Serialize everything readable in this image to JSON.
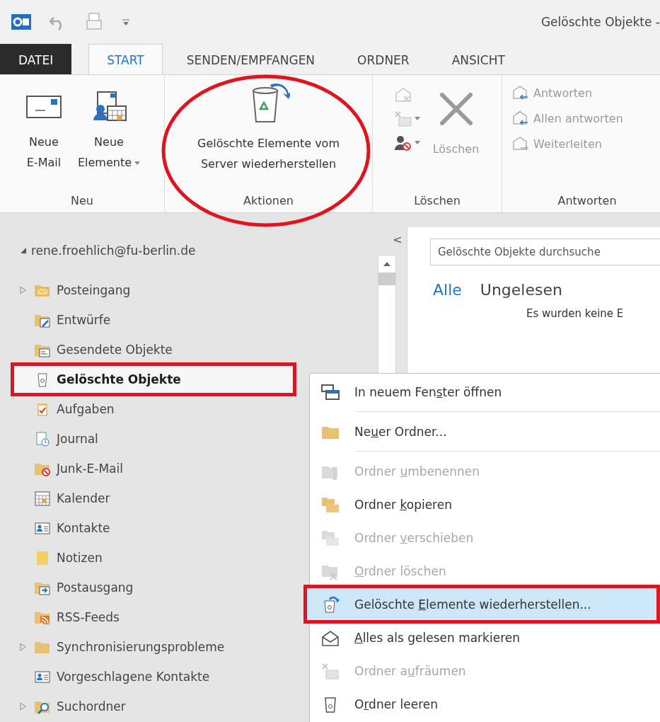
{
  "title_bar": {
    "title": "Gelöschte Objekte -"
  },
  "ribbon_tabs": [
    {
      "label": "DATEI",
      "kind": "backstage",
      "selected": false
    },
    {
      "label": "START",
      "kind": "tab",
      "selected": true
    },
    {
      "label": "SENDEN/EMPFANGEN",
      "kind": "tab",
      "selected": false
    },
    {
      "label": "ORDNER",
      "kind": "tab",
      "selected": false
    },
    {
      "label": "ANSICHT",
      "kind": "tab",
      "selected": false
    }
  ],
  "ribbon_groups": [
    {
      "label": "Neu",
      "buttons": [
        {
          "lines": [
            "Neue",
            "E-Mail"
          ],
          "dropdown": false,
          "disabled": false,
          "annotated": false
        },
        {
          "lines": [
            "Neue",
            "Elemente"
          ],
          "dropdown": true,
          "disabled": false,
          "annotated": false
        }
      ]
    },
    {
      "label": "Aktionen",
      "buttons": [
        {
          "lines": [
            "Gelöschte Elemente vom",
            "Server wiederherstellen"
          ],
          "dropdown": false,
          "disabled": false,
          "annotated": true
        }
      ]
    },
    {
      "label": "Löschen",
      "small_buttons": [
        {
          "dropdown": false,
          "disabled": true
        },
        {
          "dropdown": true,
          "disabled": true
        },
        {
          "dropdown": true,
          "disabled": false
        }
      ],
      "buttons": [
        {
          "lines": [
            "Löschen"
          ],
          "dropdown": false,
          "disabled": true,
          "annotated": false
        }
      ]
    },
    {
      "label": "Antworten",
      "rows": [
        {
          "label": "Antworten",
          "disabled": true
        },
        {
          "label": "Allen antworten",
          "disabled": true
        },
        {
          "label": "Weiterleiten",
          "disabled": true
        }
      ]
    }
  ],
  "navigation": {
    "account": {
      "label": "rene.froehlich@fu-berlin.de",
      "expanded": true
    },
    "folders": [
      {
        "label": "Posteingang",
        "collapsed": true,
        "selected": false,
        "annotated": false
      },
      {
        "label": "Entwürfe",
        "collapsed": false,
        "selected": false,
        "annotated": false
      },
      {
        "label": "Gesendete Objekte",
        "collapsed": false,
        "selected": false,
        "annotated": false
      },
      {
        "label": "Gelöschte Objekte",
        "collapsed": false,
        "selected": true,
        "annotated": true
      },
      {
        "label": "Aufgaben",
        "collapsed": false,
        "selected": false,
        "annotated": false
      },
      {
        "label": "Journal",
        "collapsed": false,
        "selected": false,
        "annotated": false
      },
      {
        "label": "Junk-E-Mail",
        "collapsed": false,
        "selected": false,
        "annotated": false
      },
      {
        "label": "Kalender",
        "collapsed": false,
        "selected": false,
        "annotated": false
      },
      {
        "label": "Kontakte",
        "collapsed": false,
        "selected": false,
        "annotated": false
      },
      {
        "label": "Notizen",
        "collapsed": false,
        "selected": false,
        "annotated": false
      },
      {
        "label": "Postausgang",
        "collapsed": false,
        "selected": false,
        "annotated": false
      },
      {
        "label": "RSS-Feeds",
        "collapsed": false,
        "selected": false,
        "annotated": false
      },
      {
        "label": "Synchronisierungsprobleme",
        "collapsed": true,
        "selected": false,
        "annotated": false
      },
      {
        "label": "Vorgeschlagene Kontakte",
        "collapsed": false,
        "selected": false,
        "annotated": false
      },
      {
        "label": "Suchordner",
        "collapsed": true,
        "selected": false,
        "annotated": false
      }
    ]
  },
  "content": {
    "collapse_glyph": "<",
    "search": {
      "placeholder": "Gelöschte Objekte durchsuche"
    },
    "filters": [
      {
        "label": "Alle",
        "selected": true
      },
      {
        "label": "Ungelesen",
        "selected": false
      }
    ],
    "empty_message": "Es wurden keine E"
  },
  "context_menu": [
    {
      "before": "In neuem Fen",
      "key": "s",
      "after": "ter öffnen",
      "disabled": false,
      "selected": false,
      "annotated": false,
      "separator_after": true
    },
    {
      "before": "Ne",
      "key": "u",
      "after": "er Ordner...",
      "disabled": false,
      "selected": false,
      "annotated": false,
      "separator_after": true
    },
    {
      "before": "Ordner ",
      "key": "u",
      "after": "mbenennen",
      "disabled": true,
      "selected": false,
      "annotated": false,
      "separator_after": false
    },
    {
      "before": "Ordner ",
      "key": "k",
      "after": "opieren",
      "disabled": false,
      "selected": false,
      "annotated": false,
      "separator_after": false
    },
    {
      "before": "Ordner ",
      "key": "v",
      "after": "erschieben",
      "disabled": true,
      "selected": false,
      "annotated": false,
      "separator_after": false
    },
    {
      "key": "O",
      "after": "rdner löschen",
      "disabled": true,
      "selected": false,
      "annotated": false,
      "separator_after": false
    },
    {
      "before": "Gelöschte ",
      "key": "E",
      "after": "lemente wiederherstellen...",
      "disabled": false,
      "selected": true,
      "annotated": true,
      "separator_after": false
    },
    {
      "key": "A",
      "after": "lles als gelesen markieren",
      "disabled": false,
      "selected": false,
      "annotated": false,
      "separator_after": false
    },
    {
      "before": "Ordner a",
      "key": "u",
      "after": "fräumen",
      "disabled": true,
      "selected": false,
      "annotated": false,
      "separator_after": false
    },
    {
      "before": "O",
      "key": "r",
      "after": "dner leeren",
      "disabled": false,
      "selected": false,
      "annotated": false,
      "separator_after": false
    }
  ]
}
